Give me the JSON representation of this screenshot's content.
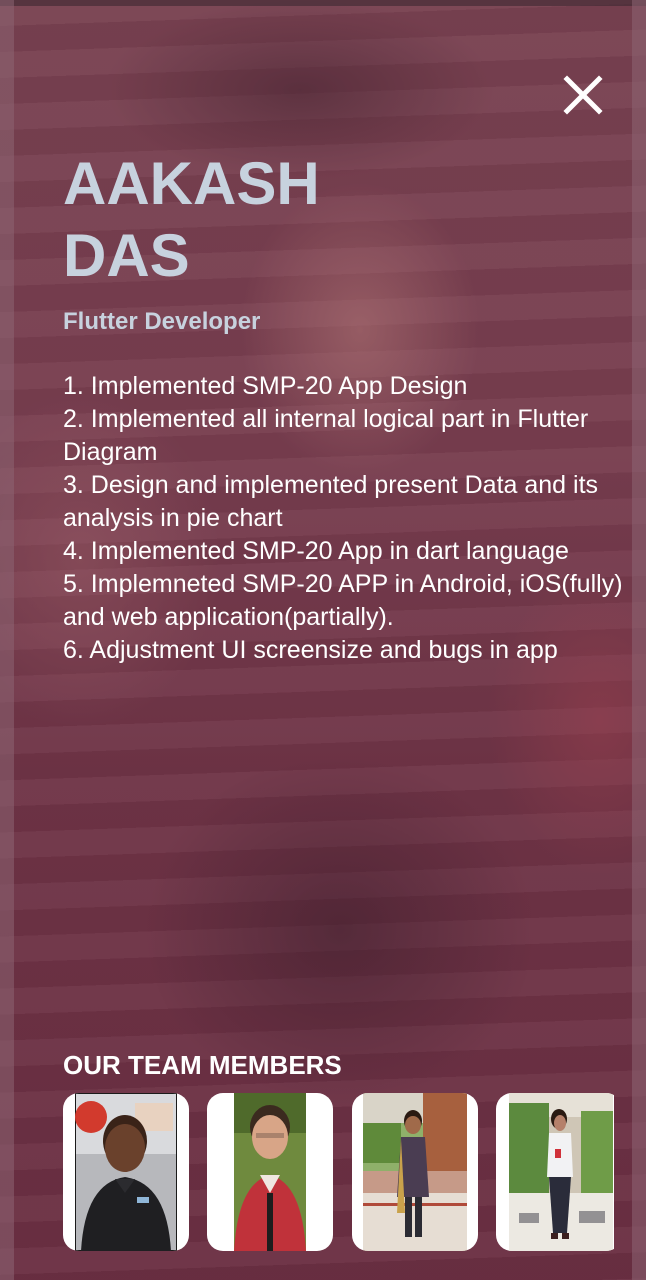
{
  "profile": {
    "first_name": "AAKASH",
    "last_name": "DAS",
    "role": "Flutter Developer",
    "contributions": [
      "1. Implemented SMP-20 App Design",
      "2. Implemented all internal logical part in Flutter Diagram",
      "3. Design and implemented present Data and its analysis in pie chart",
      "4. Implemented SMP-20 App in dart language",
      "5. Implemneted SMP-20 APP in Android, iOS(fully) and web application(partially).",
      "6. Adjustment UI screensize and bugs in app"
    ]
  },
  "team": {
    "title": "OUR TEAM MEMBERS",
    "members": [
      {
        "icon": "member-photo-1"
      },
      {
        "icon": "member-photo-2"
      },
      {
        "icon": "member-photo-3"
      },
      {
        "icon": "member-photo-4"
      }
    ]
  },
  "colors": {
    "name_text": "#c7d2de",
    "body_text": "#ffffff",
    "overlay": "#6f3b4d"
  },
  "icons": {
    "close": "close-icon"
  }
}
